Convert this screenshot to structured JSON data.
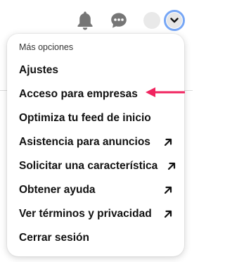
{
  "header": {
    "icons": [
      "bell-icon",
      "chat-bubble-icon",
      "avatar",
      "chevron-down-icon"
    ],
    "accent_color": "#76a6f5"
  },
  "menu": {
    "section_title": "Más opciones",
    "items": [
      {
        "label": "Ajustes",
        "external": false
      },
      {
        "label": "Acceso para empresas",
        "external": false
      },
      {
        "label": "Optimiza tu feed de inicio",
        "external": false
      },
      {
        "label": "Asistencia para anuncios",
        "external": true
      },
      {
        "label": "Solicitar una característica",
        "external": true
      },
      {
        "label": "Obtener ayuda",
        "external": true
      },
      {
        "label": "Ver términos y privacidad",
        "external": true
      },
      {
        "label": "Cerrar sesión",
        "external": false
      }
    ]
  },
  "annotation": {
    "arrow_color": "#f0245f",
    "target_item": "Acceso para empresas"
  }
}
